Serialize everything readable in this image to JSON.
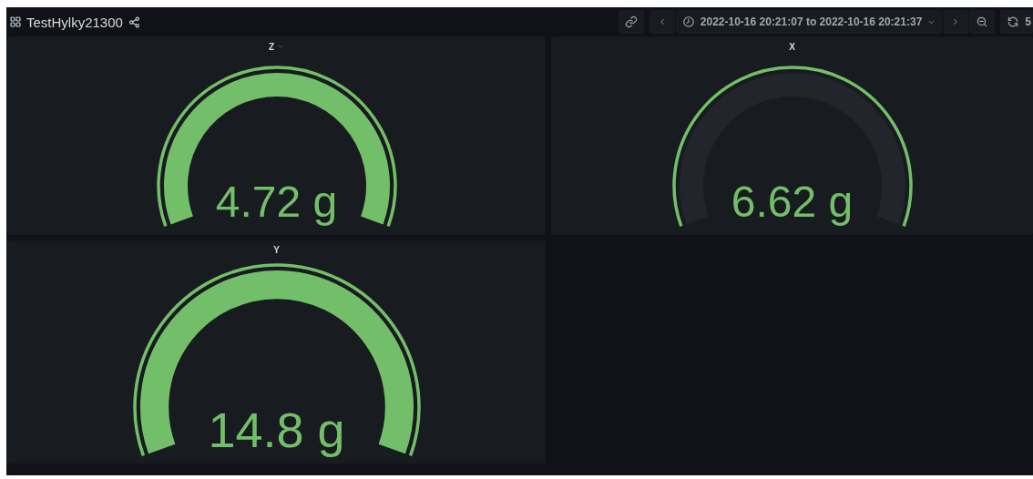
{
  "dashboard": {
    "title": "TestHylky21300"
  },
  "time_range": {
    "label": "2022-10-16 20:21:07 to 2022-10-16 20:21:37"
  },
  "refresh": {
    "label": "5"
  },
  "panels": [
    {
      "title": "Z",
      "menu_open": true,
      "value": "4.72 g",
      "kind": "filled"
    },
    {
      "title": "X",
      "menu_open": false,
      "value": "6.62 g",
      "kind": "empty"
    },
    {
      "title": "Y",
      "menu_open": false,
      "value": "14.8 g",
      "kind": "filled"
    }
  ]
}
